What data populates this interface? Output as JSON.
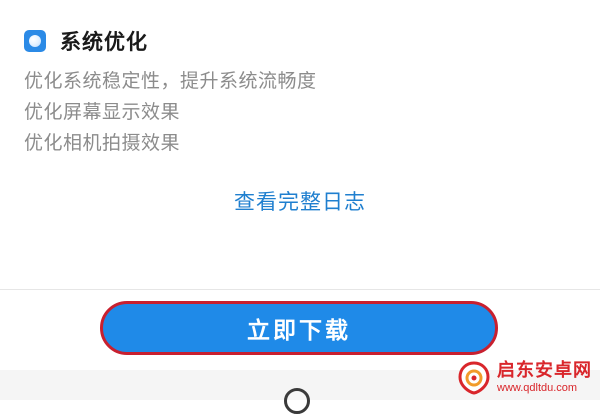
{
  "section": {
    "icon": "system-optimize-icon",
    "title": "系统优化",
    "items": [
      "优化系统稳定性，提升系统流畅度",
      "优化屏幕显示效果",
      "优化相机拍摄效果"
    ]
  },
  "links": {
    "full_log": "查看完整日志"
  },
  "actions": {
    "download_label": "立即下载"
  },
  "nav": {
    "home_icon": "home-circle-icon"
  },
  "watermark": {
    "name": "启东安卓网",
    "url": "www.qdltdu.com",
    "logo_icon": "watermark-logo-icon"
  },
  "colors": {
    "accent": "#1f8ae8",
    "link": "#1f7fcf",
    "highlight_border": "#c8202f",
    "watermark": "#d9262b"
  }
}
